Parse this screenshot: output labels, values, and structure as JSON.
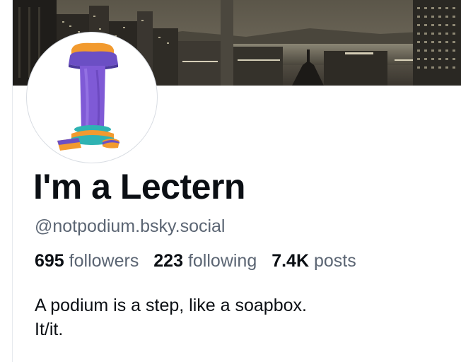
{
  "profile": {
    "display_name": "I'm a Lectern",
    "handle": "@notpodium.bsky.social",
    "stats": {
      "followers_count": "695",
      "followers_label": "followers",
      "following_count": "223",
      "following_label": "following",
      "posts_count": "7.4K",
      "posts_label": "posts"
    },
    "bio_lines": [
      "A podium is a step, like a soapbox.",
      "It/it."
    ]
  },
  "colors": {
    "text_primary": "#0b0f14",
    "text_secondary": "#5b6573",
    "background": "#ffffff"
  },
  "icons": {
    "avatar": "purple-pillar-lectern-image",
    "banner": "night-city-skyline-image"
  }
}
